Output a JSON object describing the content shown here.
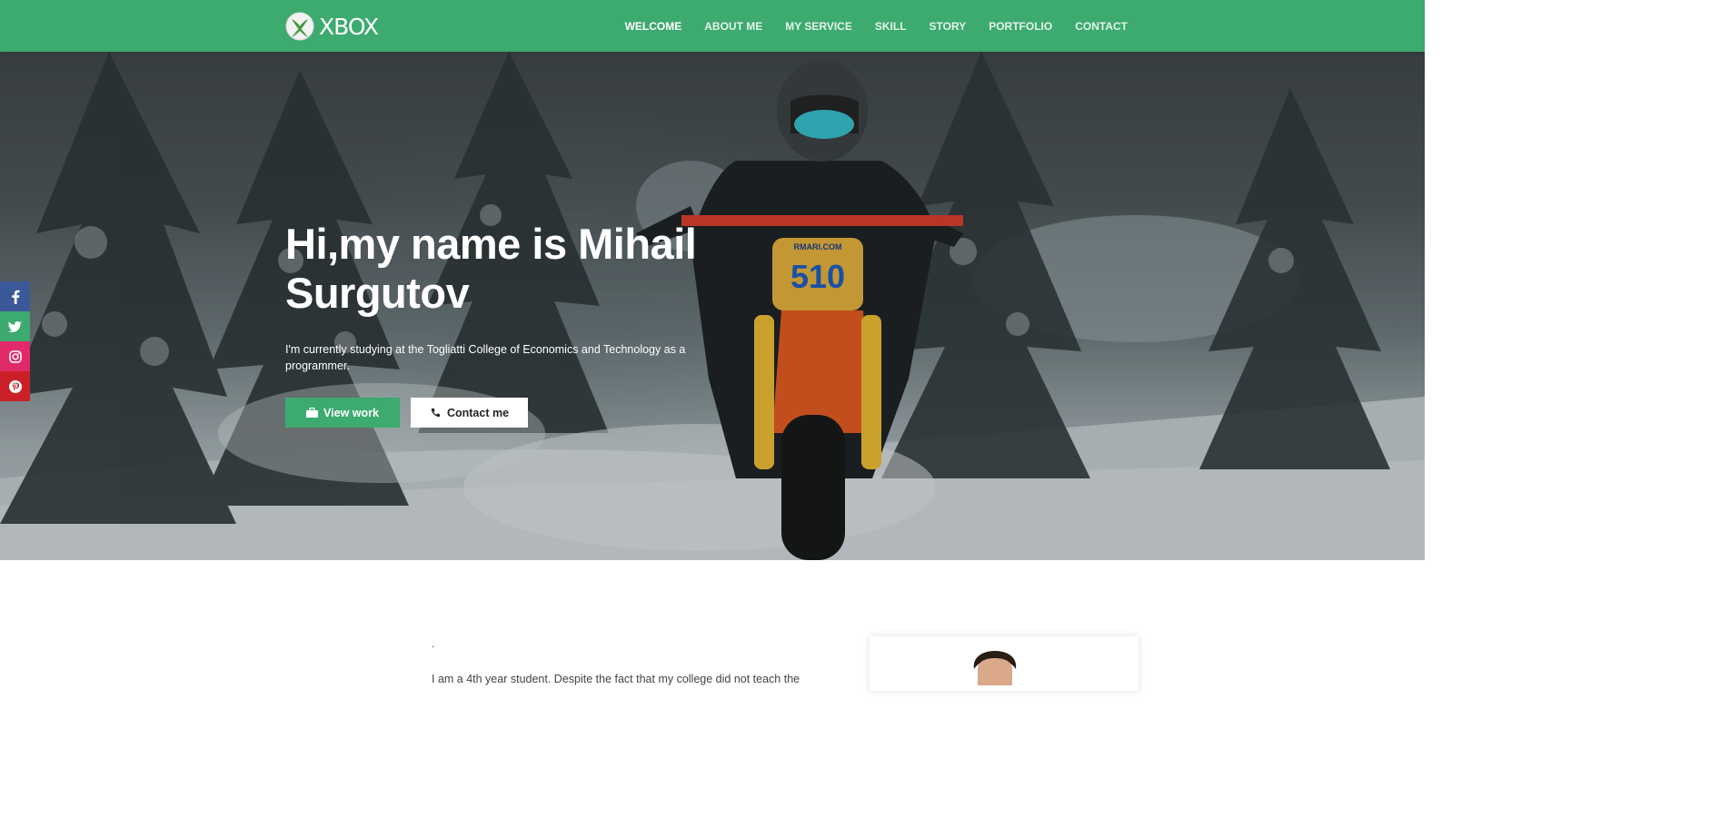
{
  "brand": {
    "name": "XBOX"
  },
  "nav": {
    "items": [
      {
        "label": "WELCOME",
        "active": true
      },
      {
        "label": "ABOUT ME",
        "active": false
      },
      {
        "label": "MY SERVICE",
        "active": false
      },
      {
        "label": "SKILL",
        "active": false
      },
      {
        "label": "STORY",
        "active": false
      },
      {
        "label": "PORTFOLIO",
        "active": false
      },
      {
        "label": "CONTACT",
        "active": false
      }
    ]
  },
  "hero": {
    "title_line1": "Hi,my name is Mihail",
    "title_line2": "Surgutov",
    "subtitle": "I'm currently studying at the Togliatti College of Economics and Technology as a programmer.",
    "view_work_label": "View work",
    "contact_label": "Contact me",
    "bike_number": "510",
    "bike_sponsor": "RMARI.COM"
  },
  "social": {
    "icons": [
      "facebook-icon",
      "twitter-icon",
      "instagram-icon",
      "pinterest-icon"
    ]
  },
  "about": {
    "dot": ".",
    "text": "I am a 4th year student. Despite the fact that my college did not teach the"
  },
  "colors": {
    "brand_green": "#3daa70",
    "facebook": "#3b5999",
    "instagram": "#e12a6a",
    "pinterest": "#cb2027"
  }
}
